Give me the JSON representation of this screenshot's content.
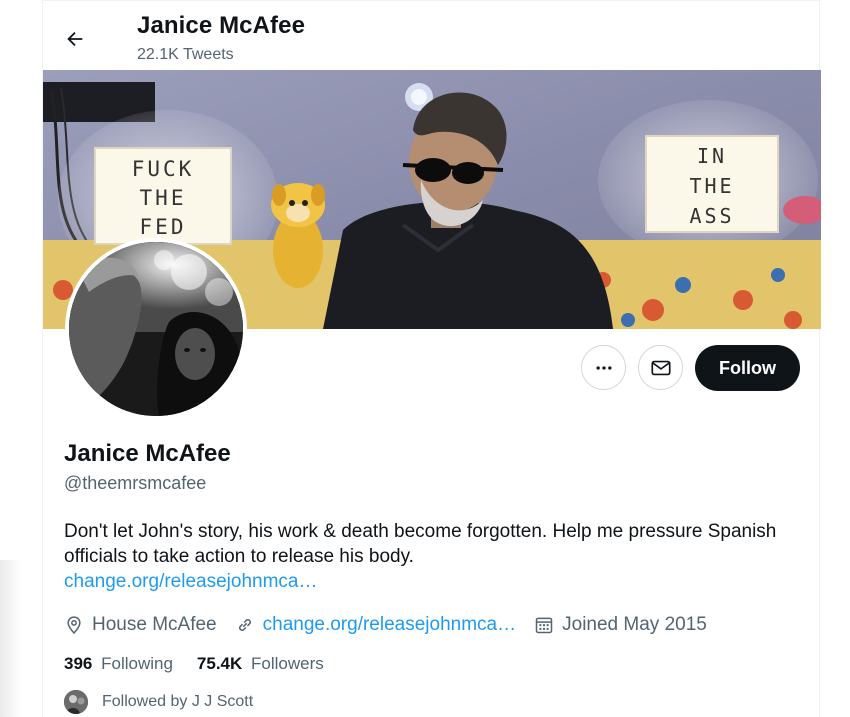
{
  "header": {
    "name": "Janice McAfee",
    "tweet_count": "22.1K Tweets",
    "back_icon": "arrow-left-icon"
  },
  "banner": {
    "left_sign": [
      "FUCK",
      "THE",
      "FED"
    ],
    "right_sign": [
      "IN",
      "THE",
      "ASS"
    ]
  },
  "actions": {
    "more_icon": "more-dots-icon",
    "message_icon": "envelope-icon",
    "follow_label": "Follow"
  },
  "profile": {
    "name": "Janice McAfee",
    "handle": "@theemrsmcafee",
    "bio": "Don't let John's story, his work & death become forgotten. Help me pressure Spanish officials to take action to release his body.",
    "bio_link": "change.org/releasejohnmca…",
    "location": "House McAfee",
    "website": "change.org/releasejohnmca…",
    "joined": "Joined May 2015"
  },
  "stats": {
    "following_count": "396",
    "following_label": "Following",
    "followers_count": "75.4K",
    "followers_label": "Followers"
  },
  "followed_by": {
    "text": "Followed by J J Scott"
  },
  "colors": {
    "accent": "#1d9bf0",
    "text_primary": "#0f1419",
    "text_secondary": "#536471",
    "follow_button_bg": "#0f1419"
  }
}
